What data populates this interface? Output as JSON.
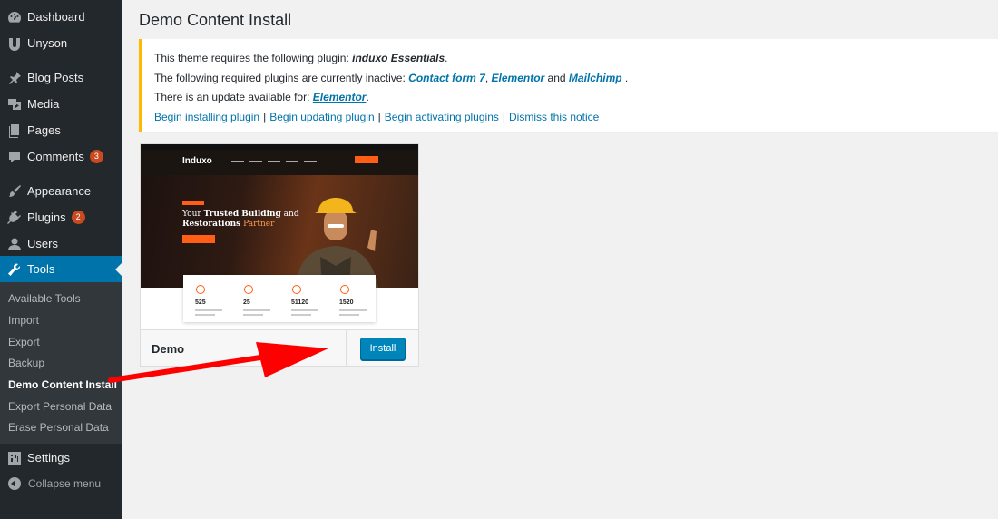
{
  "sidebar": {
    "items": [
      {
        "label": "Dashboard",
        "icon": "dashboard-icon"
      },
      {
        "label": "Unyson",
        "icon": "unyson-icon"
      },
      {
        "label": "Blog Posts",
        "icon": "pin-icon"
      },
      {
        "label": "Media",
        "icon": "media-icon"
      },
      {
        "label": "Pages",
        "icon": "pages-icon"
      },
      {
        "label": "Comments",
        "icon": "comments-icon",
        "badge": "3"
      },
      {
        "label": "Appearance",
        "icon": "brush-icon"
      },
      {
        "label": "Plugins",
        "icon": "plugin-icon",
        "badge": "2"
      },
      {
        "label": "Users",
        "icon": "users-icon"
      },
      {
        "label": "Tools",
        "icon": "wrench-icon"
      },
      {
        "label": "Settings",
        "icon": "settings-icon"
      }
    ],
    "submenu": [
      "Available Tools",
      "Import",
      "Export",
      "Backup",
      "Demo Content Install",
      "Export Personal Data",
      "Erase Personal Data"
    ],
    "collapse_label": "Collapse menu"
  },
  "page": {
    "title": "Demo Content Install"
  },
  "notice": {
    "line1_prefix": "This theme requires the following plugin: ",
    "line1_plugin": "induxo Essentials",
    "line1_suffix": ".",
    "line2_prefix": "The following required plugins are currently inactive: ",
    "line2_link1": "Contact form 7",
    "line2_comma": ", ",
    "line2_link2": "Elementor",
    "line2_and": " and ",
    "line2_link3": "Mailchimp ",
    "line2_suffix": ".",
    "line3_prefix": "There is an update available for: ",
    "line3_link": "Elementor",
    "line3_suffix": ".",
    "actions": [
      "Begin installing plugin",
      "Begin updating plugin",
      "Begin activating plugins",
      "Dismiss this notice"
    ],
    "separator": "|"
  },
  "demo": {
    "name": "Demo",
    "button": "Install",
    "preview": {
      "logo_main": "Indu",
      "logo_accent": "xo",
      "hero_line1_a": "Your ",
      "hero_line1_b": "Trusted Building",
      "hero_line1_c": " and",
      "hero_line2_a": "Restorations",
      "hero_line2_b": " Partner",
      "stats": [
        "525",
        "25",
        "51120",
        "1520"
      ]
    }
  },
  "colors": {
    "accent": "#0073aa",
    "notice_border": "#ffb900",
    "badge": "#ca4a1f",
    "arrow": "#ff0000"
  }
}
